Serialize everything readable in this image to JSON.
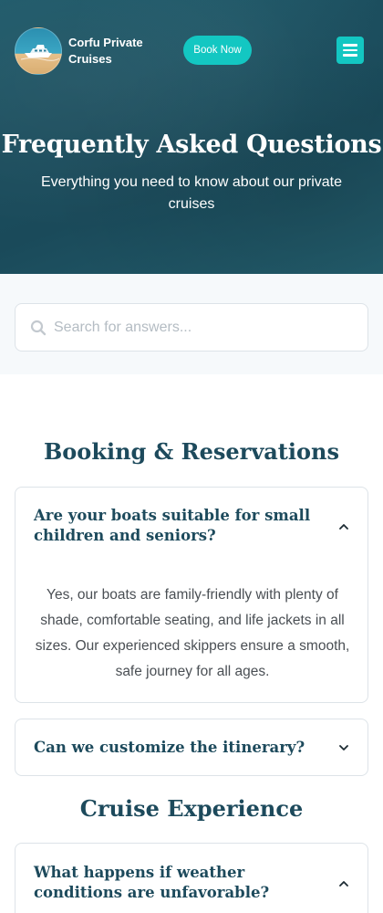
{
  "header": {
    "brand": "Corfu Private Cruises",
    "book_button": "Book Now",
    "logo_icon": "yacht-logo-icon",
    "menu_icon": "hamburger-menu-icon",
    "accent_color": "#13c7c2"
  },
  "hero": {
    "title": "Frequently Asked Questions",
    "subtitle": "Everything you need to know about our private cruises"
  },
  "search": {
    "placeholder": "Search for answers...",
    "value": "",
    "icon": "search-icon"
  },
  "sections": [
    {
      "title": "Booking & Reservations",
      "faqs": [
        {
          "question": "Are your boats suitable for small children and seniors?",
          "expanded": true,
          "answer": "Yes, our boats are family-friendly with plenty of shade, comfortable seating, and life jackets in all sizes. Our experienced skippers ensure a smooth, safe journey for all ages."
        },
        {
          "question": "Can we customize the itinerary?",
          "expanded": false
        }
      ]
    },
    {
      "title": "Cruise Experience",
      "faqs": [
        {
          "question": "What happens if weather conditions are unfavorable?",
          "expanded": true
        }
      ]
    }
  ]
}
